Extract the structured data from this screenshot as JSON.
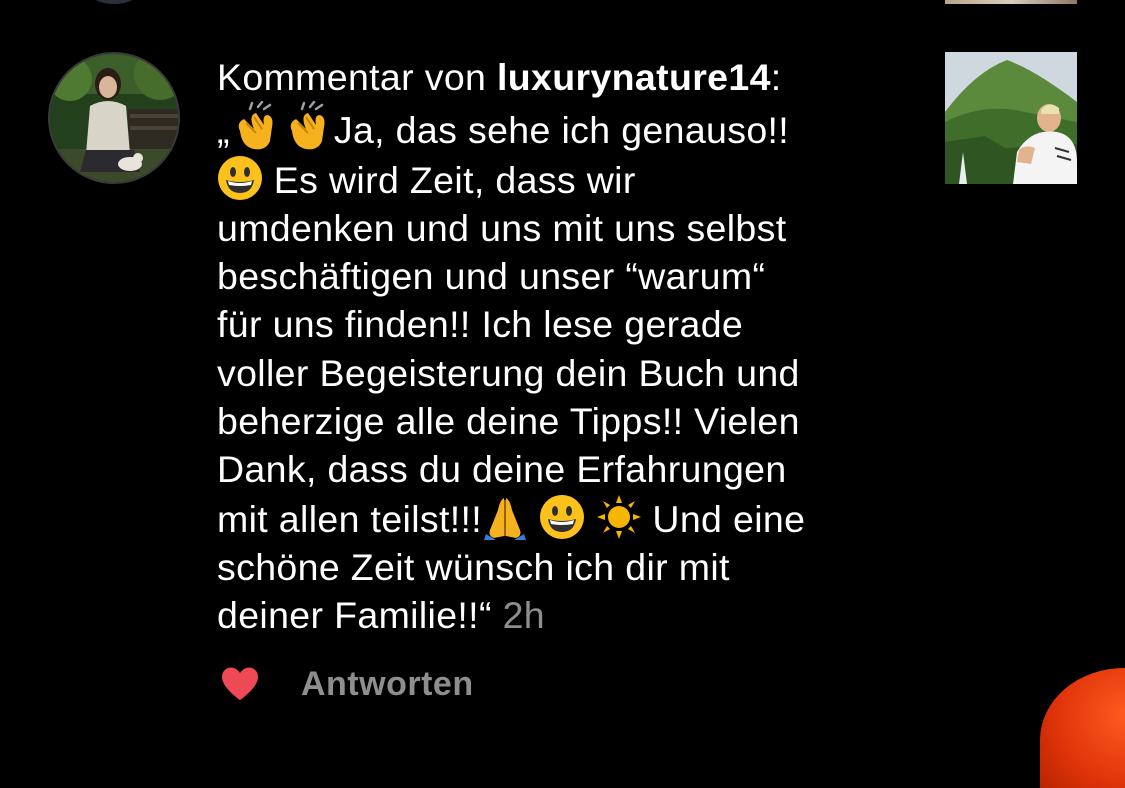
{
  "comment": {
    "prefix": "Kommentar von ",
    "username": "luxurynature14",
    "colon": ":",
    "lines": [
      [
        "„",
        "clap-emoji",
        "clap-emoji",
        "Ja, das sehe ich genauso!!"
      ],
      [
        "grinning-emoji",
        " Es wird Zeit, dass wir"
      ],
      [
        "umdenken und uns mit uns selbst"
      ],
      [
        "beschäftigen und unser “warum“"
      ],
      [
        "für uns finden!! Ich lese gerade"
      ],
      [
        "voller Begeisterung dein Buch und"
      ],
      [
        "beherzige alle deine Tipps!! Vielen"
      ],
      [
        "Dank, dass du deine Erfahrungen"
      ],
      [
        "mit allen teilst!!!",
        "pray-emoji",
        " ",
        "grinning-emoji",
        " ",
        "sun-emoji",
        " Und eine"
      ],
      [
        "schöne Zeit wünsch ich dir mit"
      ],
      [
        "deiner Familie!!“ "
      ]
    ],
    "line1_open_quote": "„",
    "line1_text": "Ja, das sehe ich genauso!!",
    "line2_text": " Es wird Zeit, dass wir",
    "line3_text": "umdenken und uns mit uns selbst",
    "line4_text": "beschäftigen und unser “warum“",
    "line5_text": "für uns finden!! Ich lese gerade",
    "line6_text": "voller Begeisterung dein Buch und",
    "line7_text": "beherzige alle deine Tipps!! Vielen",
    "line8_text": "Dank, dass du deine Erfahrungen",
    "line9_text_a": "mit allen teilst!!!",
    "line9_text_b": " Und eine",
    "line10_text": "schöne Zeit wünsch ich dir mit",
    "line11_text": "deiner Familie!!“ ",
    "time": "2h"
  },
  "actions": {
    "like_icon": "heart-icon",
    "like_color": "#ed4956",
    "reply_label": "Antworten"
  },
  "colors": {
    "background": "#000000",
    "text": "#ffffff",
    "muted": "#8e8e8e"
  }
}
